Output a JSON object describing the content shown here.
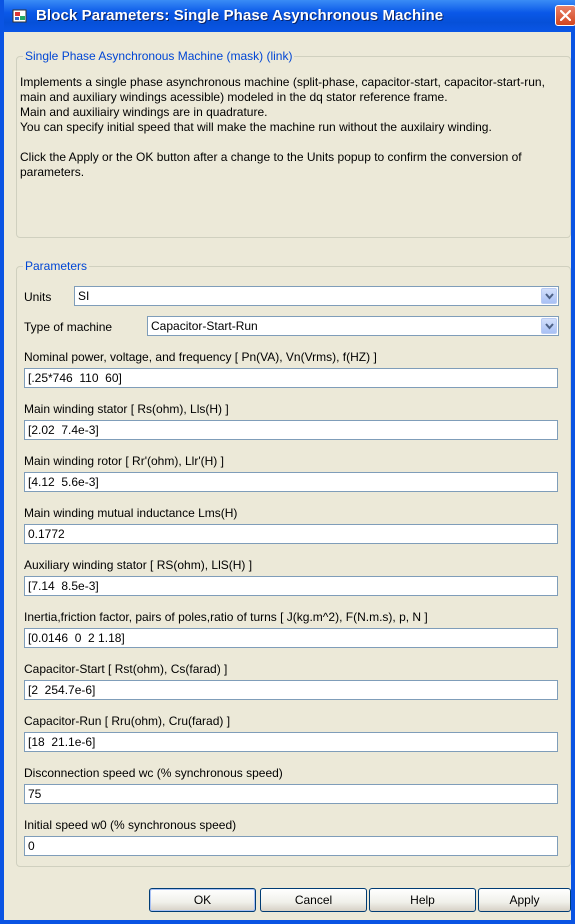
{
  "window": {
    "title": "Block Parameters: Single Phase Asynchronous Machine"
  },
  "description": {
    "group_title": "Single Phase Asynchronous Machine (mask) (link)",
    "paragraphs": [
      "Implements a single phase asynchronous machine (split-phase, capacitor-start, capacitor-start-run,  main and auxiliary windings acessible) modeled in the dq stator reference frame.",
      "Main and auxiliairy windings are in quadrature.",
      "You can specify initial speed that will make the machine run without the auxilairy winding.",
      "",
      "Click the Apply or the OK button after a change to the Units popup to confirm the conversion of parameters."
    ]
  },
  "parameters": {
    "group_title": "Parameters",
    "units": {
      "label": "Units",
      "value": "SI"
    },
    "machine_type": {
      "label": "Type of machine",
      "value": "Capacitor-Start-Run"
    },
    "fields": [
      {
        "label": "Nominal power, voltage, and frequency [ Pn(VA), Vn(Vrms), f(HZ) ]",
        "value": "[.25*746  110  60]"
      },
      {
        "label": "Main winding stator [ Rs(ohm), Lls(H) ]",
        "value": "[2.02  7.4e-3]"
      },
      {
        "label": "Main winding rotor [ Rr'(ohm), Llr'(H) ]",
        "value": "[4.12  5.6e-3]"
      },
      {
        "label": "Main winding mutual inductance Lms(H)",
        "value": "0.1772"
      },
      {
        "label": "Auxiliary  winding stator [ RS(ohm), LlS(H) ]",
        "value": "[7.14  8.5e-3]"
      },
      {
        "label": "Inertia,friction factor, pairs of poles,ratio of turns [ J(kg.m^2),  F(N.m.s),  p, N ]",
        "value": "[0.0146  0  2 1.18]"
      },
      {
        "label": "Capacitor-Start [ Rst(ohm), Cs(farad) ]",
        "value": "[2  254.7e-6]"
      },
      {
        "label": "Capacitor-Run [ Rru(ohm), Cru(farad) ]",
        "value": "[18  21.1e-6]"
      },
      {
        "label": "Disconnection speed wc (% synchronous speed)",
        "value": "75"
      },
      {
        "label": "Initial speed w0 (% synchronous speed)",
        "value": "0"
      }
    ]
  },
  "buttons": {
    "ok": "OK",
    "cancel": "Cancel",
    "help": "Help",
    "apply": "Apply"
  },
  "colors": {
    "titlebar": "#0a58e8",
    "group_title": "#0046d5",
    "dialog_bg": "#ece9d8",
    "close_button": "#d2451e"
  },
  "icons": {
    "app": "simulink-block-icon",
    "close": "close-icon",
    "dropdown": "chevron-down-icon"
  }
}
